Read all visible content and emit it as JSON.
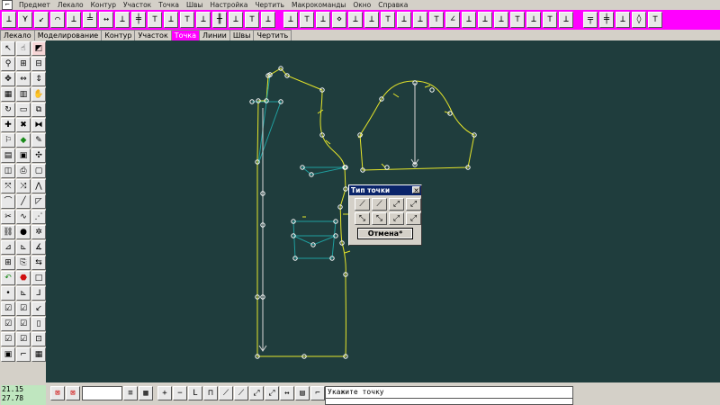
{
  "menu": [
    "Предмет",
    "Лекало",
    "Контур",
    "Участок",
    "Точка",
    "Швы",
    "Настройка",
    "Чертить",
    "Макрокоманды",
    "Окно",
    "Справка"
  ],
  "tabs": [
    {
      "label": "Лекало",
      "active": false
    },
    {
      "label": "Моделирование",
      "active": false
    },
    {
      "label": "Контур",
      "active": false
    },
    {
      "label": "Участок",
      "active": false
    },
    {
      "label": "Точка",
      "active": true
    },
    {
      "label": "Линии",
      "active": false
    },
    {
      "label": "Швы",
      "active": false
    },
    {
      "label": "Чертить",
      "active": false
    }
  ],
  "colors": {
    "toolbar_bg": "#ff00ff",
    "canvas_bg": "#1f3d3d",
    "contour": "#e6e62a",
    "construct": "#1f9e9e",
    "point": "#ffffff",
    "dialog_title": "#0a246a",
    "coords_bg": "#bfe6bf"
  },
  "dialog": {
    "title": "Тип точки",
    "close": "✕",
    "cancel": "Отмена*"
  },
  "status": {
    "x": "21.15",
    "y": "27.78",
    "prompt": "Укажите точку"
  }
}
